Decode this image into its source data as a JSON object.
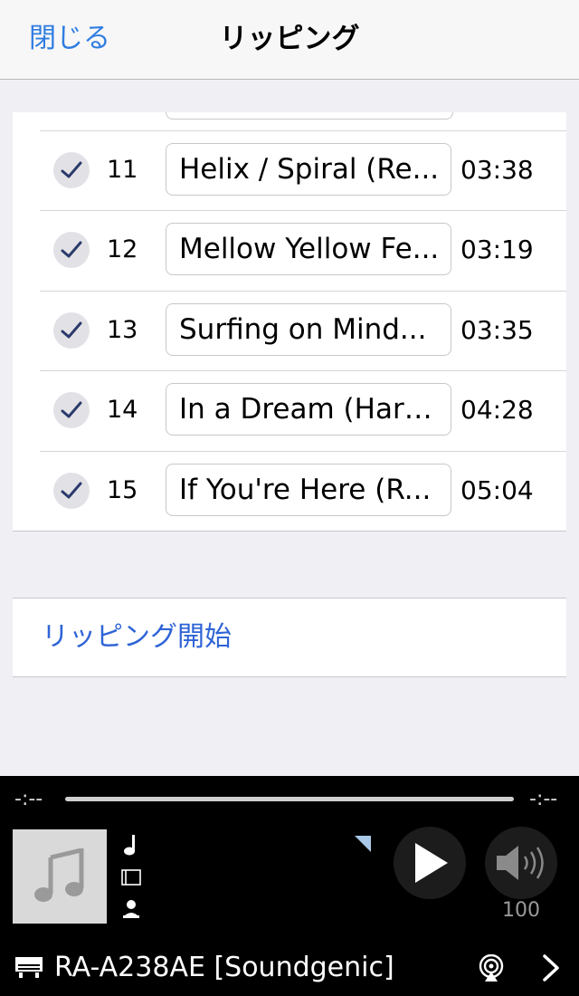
{
  "nav": {
    "close_label": "閉じる",
    "title": "リッピング"
  },
  "tracks": [
    {
      "number": "11",
      "title": "Helix / Spiral (Re...",
      "duration": "03:38",
      "checked": true
    },
    {
      "number": "12",
      "title": "Mellow Yellow Fe...",
      "duration": "03:19",
      "checked": true
    },
    {
      "number": "13",
      "title": "Surfing on Mind...",
      "duration": "03:35",
      "checked": true
    },
    {
      "number": "14",
      "title": "In a Dream (Haru...",
      "duration": "04:28",
      "checked": true
    },
    {
      "number": "15",
      "title": "If You're Here (R...",
      "duration": "05:04",
      "checked": true
    }
  ],
  "rip_start_label": "リッピング開始",
  "player": {
    "elapsed": "-:--",
    "remaining": "-:--",
    "progress": 0,
    "volume": "100",
    "device_name": "RA-A238AE [Soundgenic]",
    "icons": [
      "music-note-icon",
      "album-icon",
      "artist-icon",
      "play-icon",
      "volume-icon",
      "device-icon",
      "airplay-icon",
      "chevron-right-icon"
    ]
  },
  "colors": {
    "link_blue": "#2f7de1",
    "rip_blue": "#2f64d6",
    "check_mark": "#2b3a6b",
    "player_bg": "#000000"
  }
}
